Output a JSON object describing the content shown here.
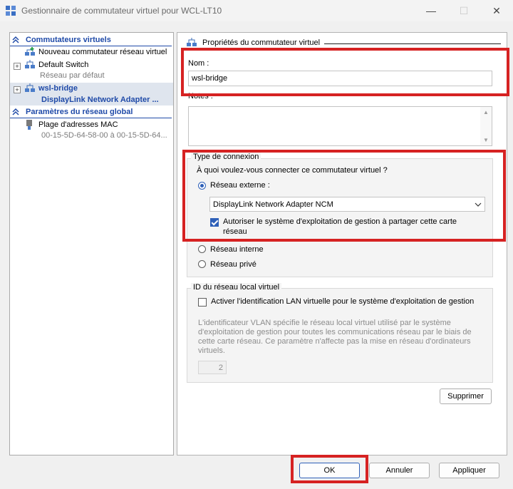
{
  "window": {
    "title": "Gestionnaire de commutateur virtuel pour WCL-LT10",
    "controls": {
      "minimize": "—",
      "maximize": "☐",
      "close": "✕"
    }
  },
  "left": {
    "section_virtual_switches": "Commutateurs virtuels",
    "new_switch": "Nouveau commutateur réseau virtuel",
    "switches": [
      {
        "name": "Default Switch",
        "sub": "Réseau par défaut"
      },
      {
        "name": "wsl-bridge",
        "sub": "DisplayLink Network Adapter ..."
      }
    ],
    "section_global": "Paramètres du réseau global",
    "mac_range": {
      "name": "Plage d'adresses MAC",
      "sub": "00-15-5D-64-58-00 à 00-15-5D-64..."
    }
  },
  "right": {
    "header": "Propriétés du commutateur virtuel",
    "name_label": "Nom :",
    "name_value": "wsl-bridge",
    "notes_label": "Notes :",
    "notes_value": "",
    "connection": {
      "title": "Type de connexion",
      "question": "À quoi voulez-vous connecter ce commutateur virtuel ?",
      "external": "Réseau externe :",
      "adapter_selected": "DisplayLink Network Adapter NCM",
      "allow_mgmt": "Autoriser le système d'exploitation de gestion à partager cette carte",
      "allow_mgmt_line2": "réseau",
      "internal": "Réseau interne",
      "private": "Réseau privé"
    },
    "vlan": {
      "title": "ID du réseau local virtuel",
      "enable": "Activer l'identification LAN virtuelle pour le système d'exploitation de gestion",
      "desc_lines": [
        "L'identificateur VLAN spécifie le réseau local virtuel utilisé par le système",
        "d'exploitation de gestion pour toutes les communications réseau par le biais de",
        "cette carte réseau. Ce paramètre n'affecte pas la mise en réseau d'ordinateurs",
        "virtuels."
      ],
      "id_value": "2"
    },
    "remove": "Supprimer"
  },
  "buttons": {
    "ok": "OK",
    "cancel": "Annuler",
    "apply": "Appliquer"
  },
  "colors": {
    "accent": "#2e60b8",
    "section_blue": "#1f4aa8",
    "highlight_red": "#d62222"
  }
}
